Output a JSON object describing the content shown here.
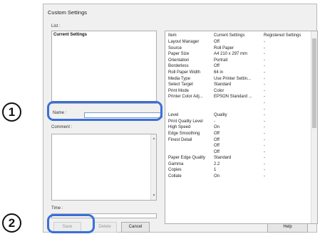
{
  "dialog": {
    "title": "Custom Settings",
    "list_label": "List :",
    "list_items": [
      "Current Settings"
    ],
    "name_label": "Name :",
    "name_value": "",
    "comment_label": "Comment :",
    "time_label": "Time :",
    "buttons": {
      "save": "Save",
      "delete": "Delete",
      "cancel": "Cancel",
      "help": "Help"
    }
  },
  "settings_table": {
    "headers": [
      "Item",
      "Current Settings",
      "Registered Settings"
    ],
    "items": [
      "Layout Manager",
      "Source",
      "Paper Size",
      "Orientation",
      "Borderless",
      "Roll Paper Width",
      "Media Type",
      "Select Target",
      "Print Mode",
      "Printer Color Adj...",
      "",
      "",
      "Level",
      "Print Quality Level",
      "High Speed",
      "Edge Smoothing",
      "Finest Detail",
      "",
      "",
      "Paper Edge Quality",
      "Gamma",
      "Copies",
      "Collate"
    ],
    "current": [
      "Off",
      "Roll Paper",
      "A4 210 x 297 mm",
      "Portrait",
      "Off",
      "64 in",
      "Use Printer Settin...",
      "Standard",
      "Color",
      "EPSON Standard ...",
      "",
      "",
      "Quality",
      "-",
      "On",
      "Off",
      "Off",
      "Off",
      "Off",
      "Standard",
      "2.2",
      "1",
      "On"
    ],
    "registered": [
      "-",
      "-",
      "-",
      "-",
      "-",
      "-",
      "-",
      "-",
      "-",
      "-",
      "-",
      "-",
      "-",
      "-",
      "-",
      "-",
      "-",
      "-",
      "-",
      "-",
      "-",
      "-",
      "-"
    ]
  },
  "annotations": {
    "step1": "1",
    "step2": "2",
    "accent": "#3a6fd8"
  }
}
